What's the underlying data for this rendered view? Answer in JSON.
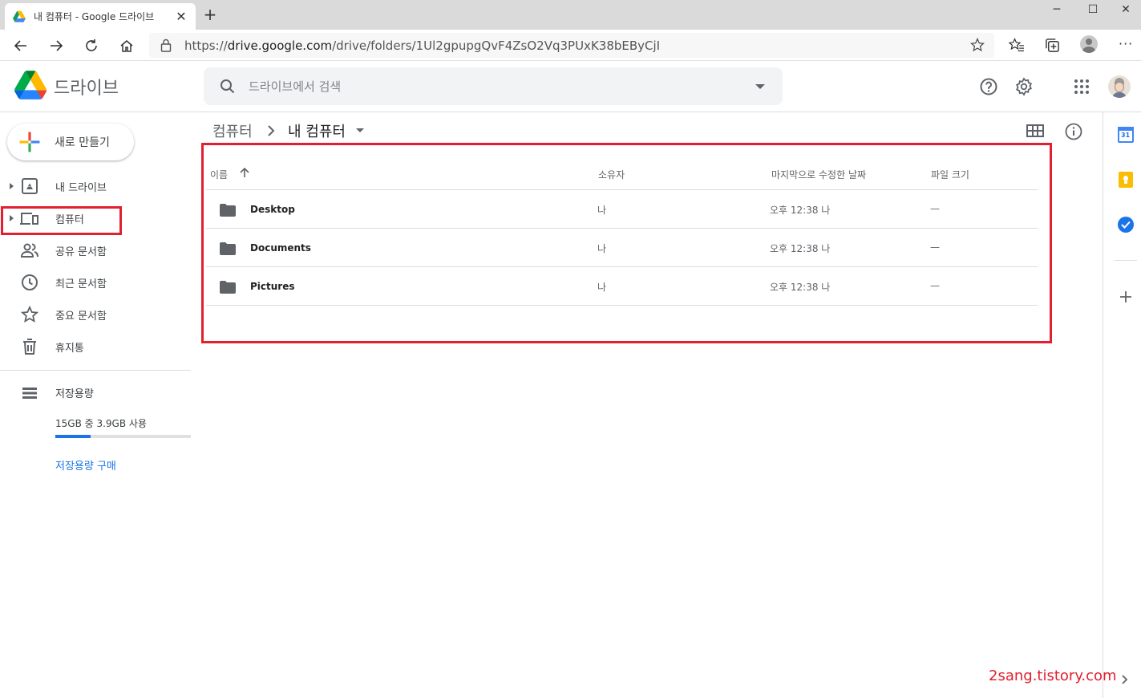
{
  "browser": {
    "tab_title": "내 컴퓨터 - Google 드라이브",
    "url_prefix": "https://",
    "url_host": "drive.google.com",
    "url_path": "/drive/folders/1Ul2gpupgQvF4ZsO2Vq3PUxK38bEByCjI"
  },
  "header": {
    "app_name": "드라이브",
    "search_placeholder": "드라이브에서 검색"
  },
  "sidebar": {
    "new_label": "새로 만들기",
    "items": [
      {
        "label": "내 드라이브",
        "icon": "my-drive-icon"
      },
      {
        "label": "컴퓨터",
        "icon": "computers-icon"
      },
      {
        "label": "공유 문서함",
        "icon": "shared-icon"
      },
      {
        "label": "최근 문서함",
        "icon": "recent-icon"
      },
      {
        "label": "중요 문서함",
        "icon": "star-icon"
      },
      {
        "label": "휴지통",
        "icon": "trash-icon"
      }
    ],
    "storage_label": "저장용량",
    "storage_used": "15GB 중 3.9GB 사용",
    "storage_fraction": 0.26,
    "buy_storage": "저장용량 구매"
  },
  "breadcrumb": {
    "parent": "컴퓨터",
    "current": "내 컴퓨터"
  },
  "table": {
    "headers": {
      "name": "이름",
      "owner": "소유자",
      "modified": "마지막으로 수정한 날짜",
      "size": "파일 크기"
    },
    "rows": [
      {
        "name": "Desktop",
        "owner": "나",
        "modified": "오후 12:38 나",
        "size": "—"
      },
      {
        "name": "Documents",
        "owner": "나",
        "modified": "오후 12:38 나",
        "size": "—"
      },
      {
        "name": "Pictures",
        "owner": "나",
        "modified": "오후 12:38 나",
        "size": "—"
      }
    ]
  },
  "side_panel": {
    "calendar_day": "31"
  },
  "watermark": "2sang.tistory.com",
  "colors": {
    "highlight": "#e2202f",
    "accent": "#1a73e8"
  }
}
